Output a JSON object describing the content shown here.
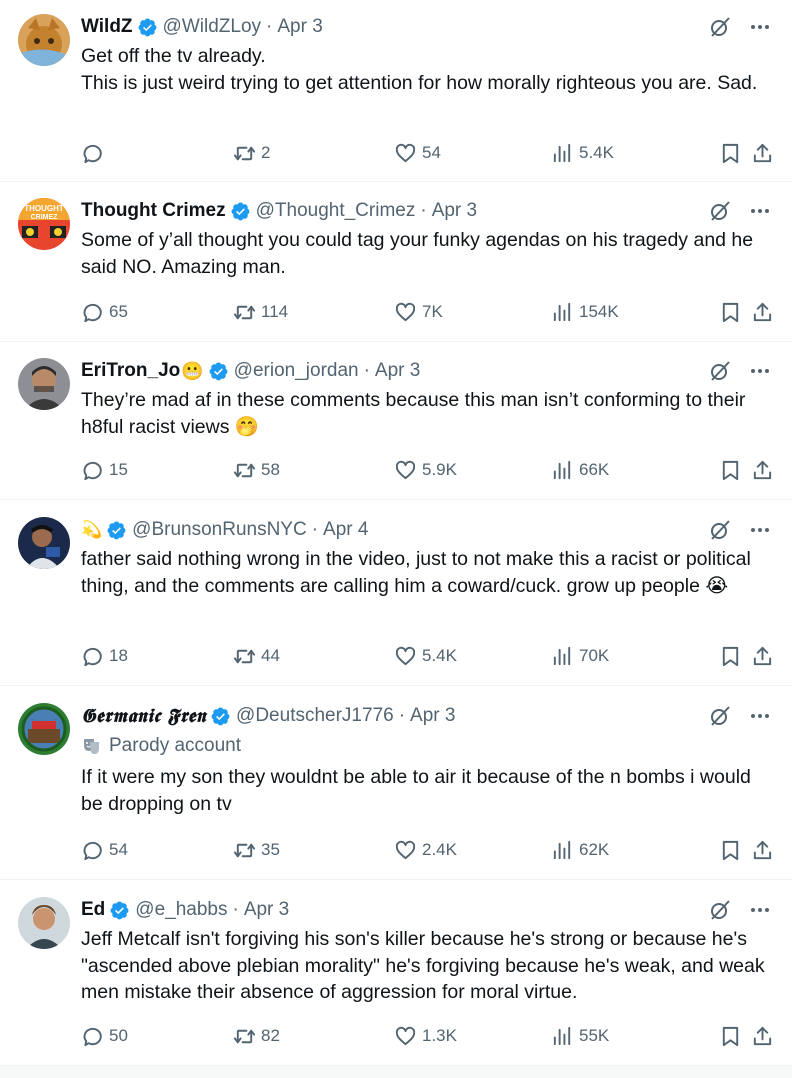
{
  "colors": {
    "accent": "#1d9bf0",
    "muted": "#536471",
    "text": "#0f1419",
    "divider": "#eff3f4"
  },
  "icons": {
    "verified": "verified-badge-icon",
    "grok": "grok-icon",
    "more": "more-icon",
    "reply": "reply-icon",
    "retweet": "retweet-icon",
    "like": "heart-icon",
    "views": "views-icon",
    "bookmark": "bookmark-icon",
    "share": "share-icon",
    "parody": "theater-masks-icon"
  },
  "tweets": [
    {
      "name": "WildZ",
      "handle": "@WildZLoy",
      "separator": "·",
      "date": "Apr 3",
      "text": "Get off the tv already.\nThis is just weird trying to get attention for how morally righteous you are. Sad.",
      "replies": "",
      "retweets": "2",
      "likes": "54",
      "views": "5.4K"
    },
    {
      "name": "Thought Crimez",
      "handle": "@Thought_Crimez",
      "separator": "·",
      "date": "Apr 3",
      "text": "Some of y’all thought you could tag your funky agendas on his tragedy and he said NO. Amazing man.",
      "replies": "65",
      "retweets": "114",
      "likes": "7K",
      "views": "154K"
    },
    {
      "name": "EriTron_Jo",
      "name_emoji": "😬",
      "handle": "@erion_jordan",
      "separator": "·",
      "date": "Apr 3",
      "text": "They’re mad af in these comments because this man isn’t conforming to their h8ful racist views 🤭",
      "replies": "15",
      "retweets": "58",
      "likes": "5.9K",
      "views": "66K"
    },
    {
      "name": "💫",
      "handle": "@BrunsonRunsNYC",
      "separator": "·",
      "date": "Apr 4",
      "text": "father said nothing wrong in the video, just to not make this a racist or political thing, and the comments are calling him a coward/cuck. grow up people 😭",
      "replies": "18",
      "retweets": "44",
      "likes": "5.4K",
      "views": "70K"
    },
    {
      "name": "𝕲𝖊𝖗𝖒𝖆𝖓𝖎𝖈 𝕱𝖗𝖊𝖓",
      "handle": "@DeutscherJ1776",
      "separator": "·",
      "date": "Apr 3",
      "parody_label": "Parody account",
      "text": "If it were my son they wouldnt be able to air it because of the n bombs i would be dropping on tv",
      "replies": "54",
      "retweets": "35",
      "likes": "2.4K",
      "views": "62K"
    },
    {
      "name": "Ed",
      "handle": "@e_habbs",
      "separator": "·",
      "date": "Apr 3",
      "text": "Jeff Metcalf isn't forgiving his son's killer because he's strong or because he's \"ascended above plebian morality\" he's forgiving because he's weak, and weak men mistake their absence of aggression for moral virtue.",
      "replies": "50",
      "retweets": "82",
      "likes": "1.3K",
      "views": "55K"
    }
  ]
}
